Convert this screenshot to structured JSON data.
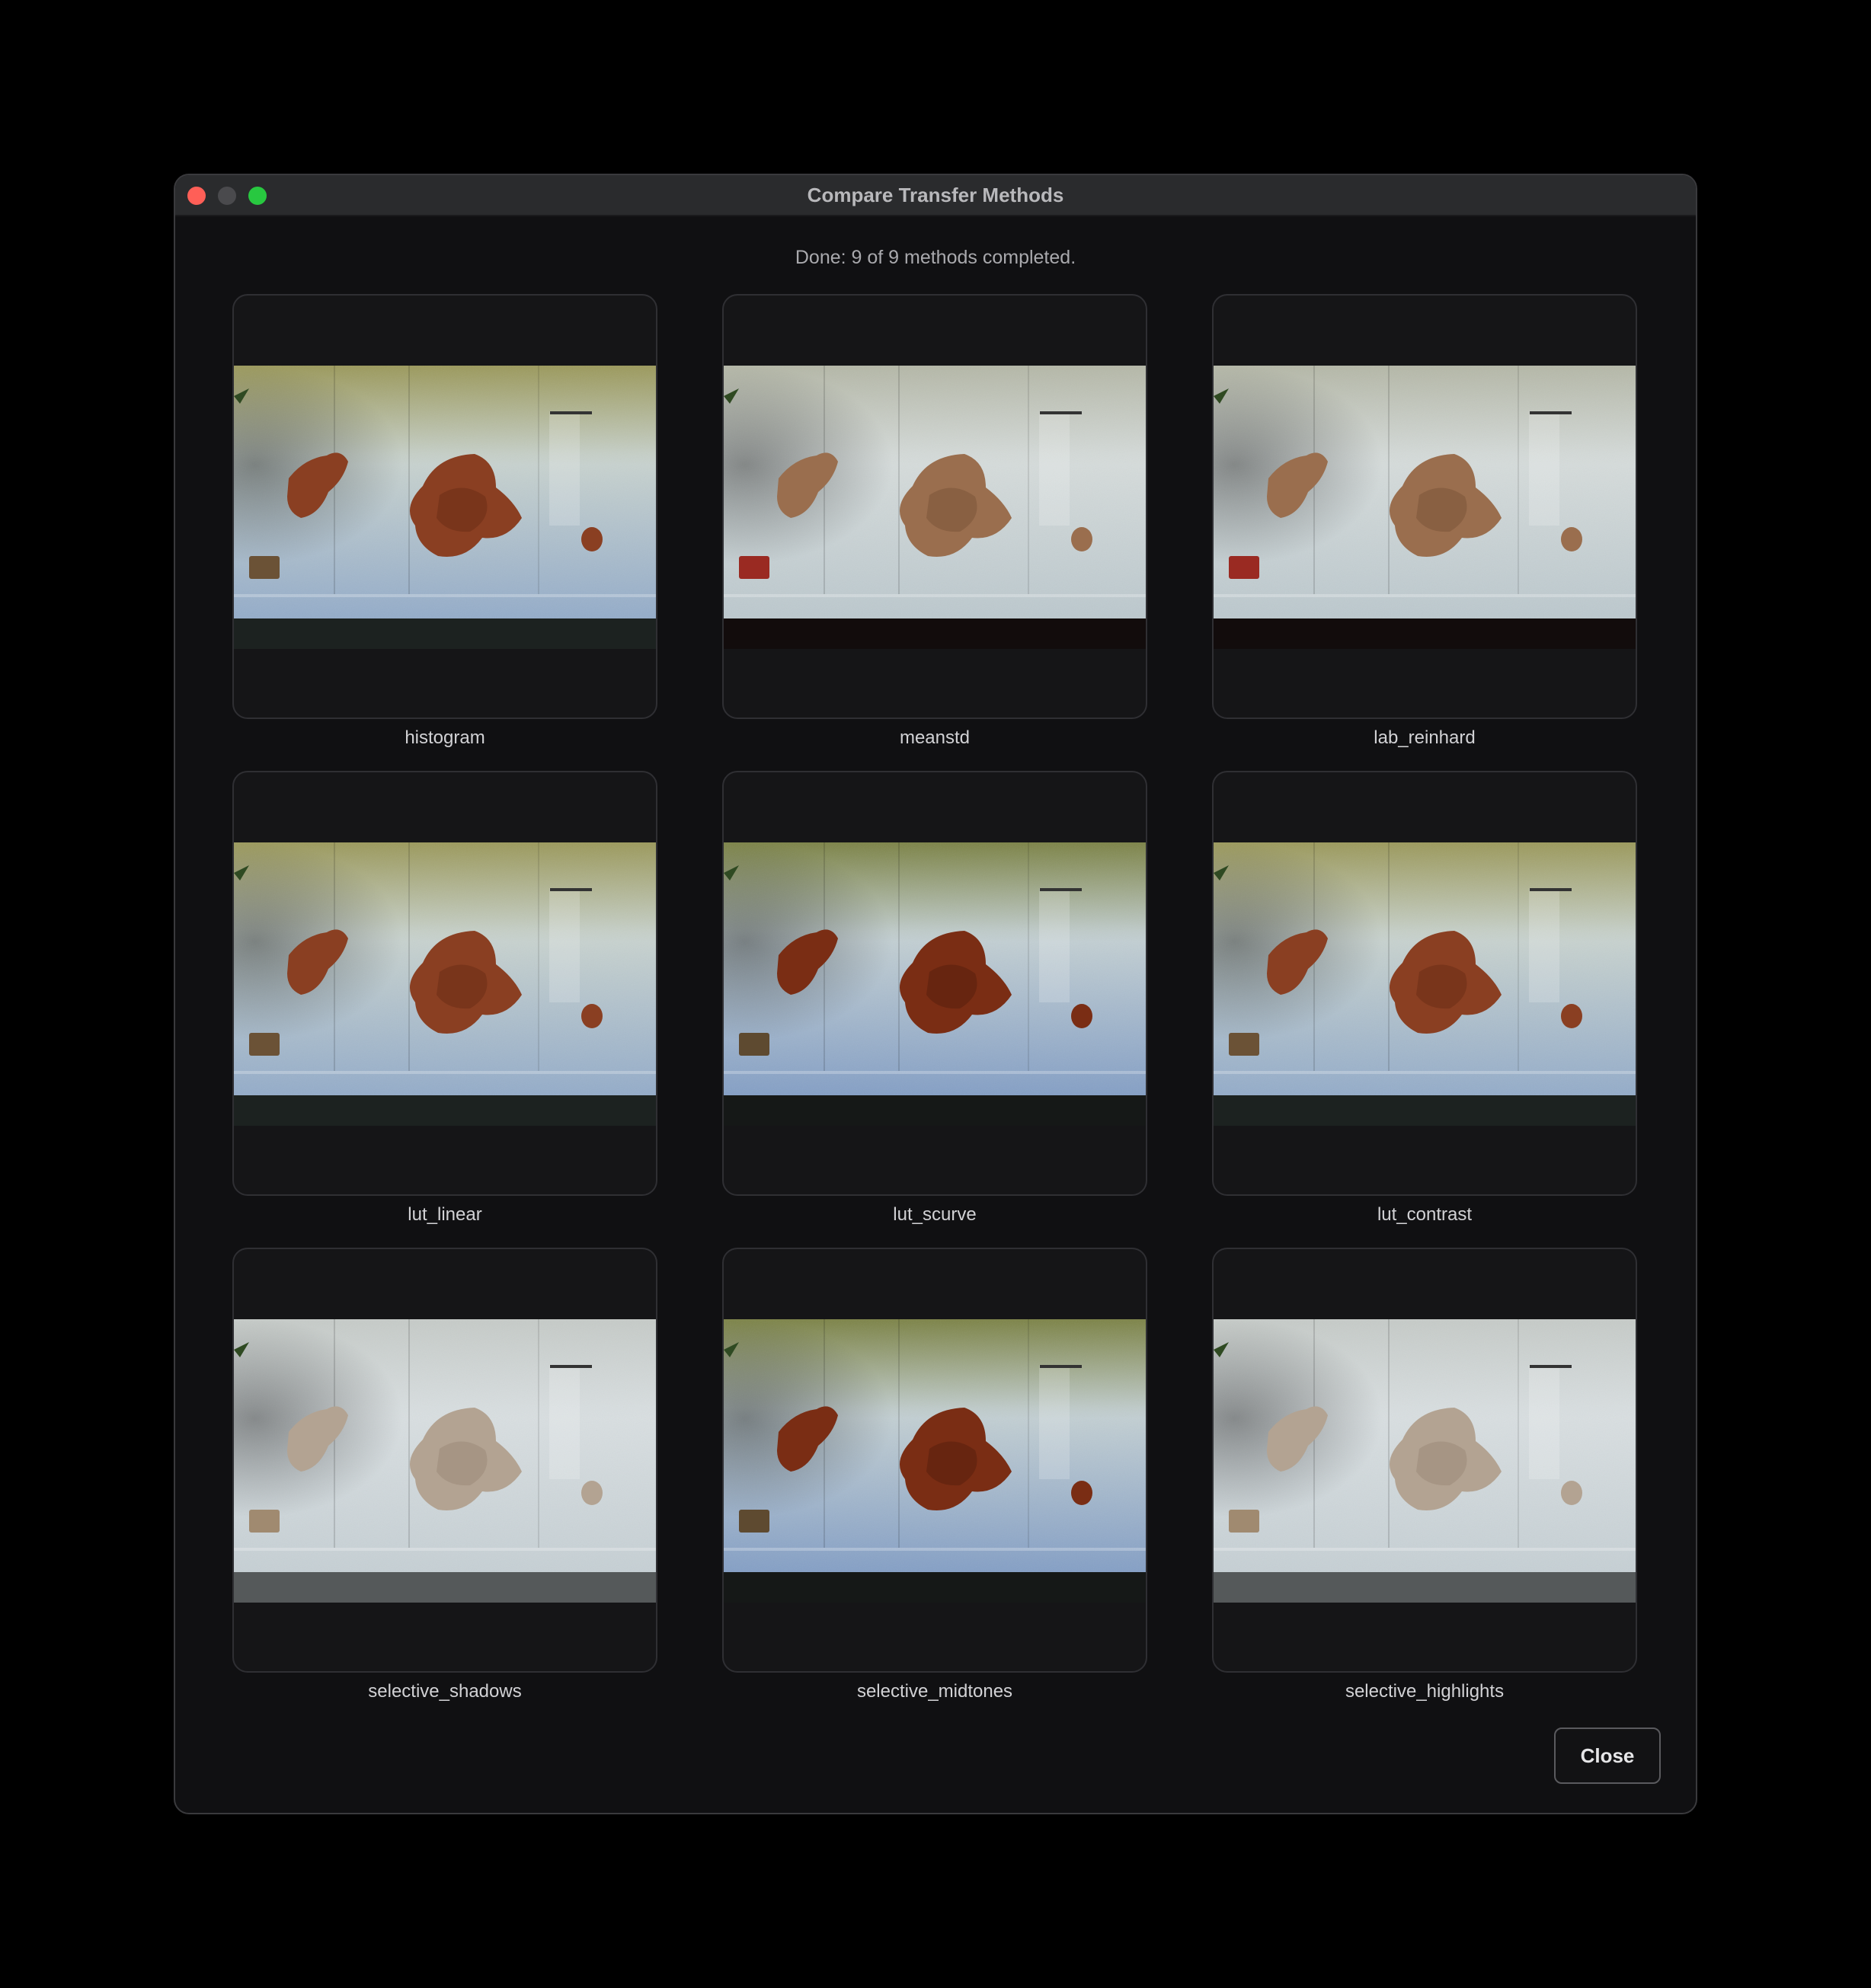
{
  "window": {
    "title": "Compare Transfer Methods",
    "traffic_lights": {
      "close_color": "#ff5f57",
      "minimize_color": "#4a4a4d",
      "maximize_color": "#28c840"
    }
  },
  "status": "Done: 9 of 9 methods completed.",
  "results": [
    {
      "label": "histogram",
      "style": "vivid"
    },
    {
      "label": "meanstd",
      "style": "muted-warm"
    },
    {
      "label": "lab_reinhard",
      "style": "muted-warm"
    },
    {
      "label": "lut_linear",
      "style": "vivid"
    },
    {
      "label": "lut_scurve",
      "style": "high-contrast"
    },
    {
      "label": "lut_contrast",
      "style": "vivid"
    },
    {
      "label": "selective_shadows",
      "style": "washed"
    },
    {
      "label": "selective_midtones",
      "style": "high-contrast"
    },
    {
      "label": "selective_highlights",
      "style": "washed"
    }
  ],
  "close_label": "Close"
}
